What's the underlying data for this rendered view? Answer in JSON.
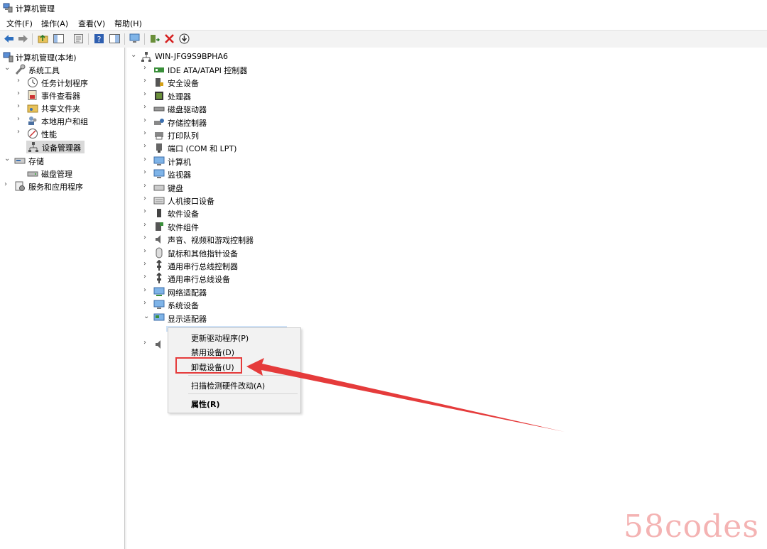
{
  "window": {
    "title": "计算机管理"
  },
  "menu": [
    "文件(F)",
    "操作(A)",
    "查看(V)",
    "帮助(H)"
  ],
  "left_tree": {
    "root": "计算机管理(本地)",
    "system_tools": "系统工具",
    "task_scheduler": "任务计划程序",
    "event_viewer": "事件查看器",
    "shared_folders": "共享文件夹",
    "local_users": "本地用户和组",
    "performance": "性能",
    "device_manager": "设备管理器",
    "storage": "存储",
    "disk_management": "磁盘管理",
    "services": "服务和应用程序"
  },
  "device_tree": {
    "computer_name": "WIN-JFG9S9BPHA6",
    "categories": [
      "IDE ATA/ATAPI 控制器",
      "安全设备",
      "处理器",
      "磁盘驱动器",
      "存储控制器",
      "打印队列",
      "端口 (COM 和 LPT)",
      "计算机",
      "监视器",
      "键盘",
      "人机接口设备",
      "软件设备",
      "软件组件",
      "声音、视频和游戏控制器",
      "鼠标和其他指针设备",
      "通用串行总线控制器",
      "通用串行总线设备",
      "网络适配器",
      "系统设备",
      "显示适配器"
    ]
  },
  "context_menu": {
    "update_driver": "更新驱动程序(P)",
    "disable_device": "禁用设备(D)",
    "uninstall_device": "卸载设备(U)",
    "scan_hardware": "扫描检测硬件改动(A)",
    "properties": "属性(R)"
  },
  "watermark": "58codes",
  "colors": {
    "highlight": "#e53b3b",
    "watermark": "#f4b3b3",
    "selection": "#d9d9d9"
  }
}
